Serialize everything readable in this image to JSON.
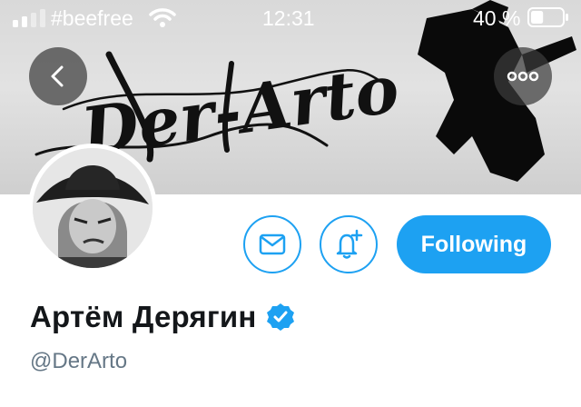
{
  "status_bar": {
    "carrier": "#beefree",
    "time": "12:31",
    "battery_percent": "40 %",
    "battery_level": 0.4,
    "icons": [
      "signal-icon",
      "wifi-icon",
      "battery-icon"
    ]
  },
  "header": {
    "banner_text": "Der-Arto",
    "back_icon": "chevron-left-icon",
    "more_icon": "more-dots-icon"
  },
  "actions": {
    "message_icon": "envelope-icon",
    "notify_icon": "bell-plus-icon",
    "follow_label": "Following"
  },
  "profile": {
    "name": "Артём Дерягин",
    "handle": "@DerArto",
    "verified": true
  },
  "colors": {
    "accent": "#1da1f2",
    "text_primary": "#14171a",
    "text_secondary": "#657786"
  }
}
